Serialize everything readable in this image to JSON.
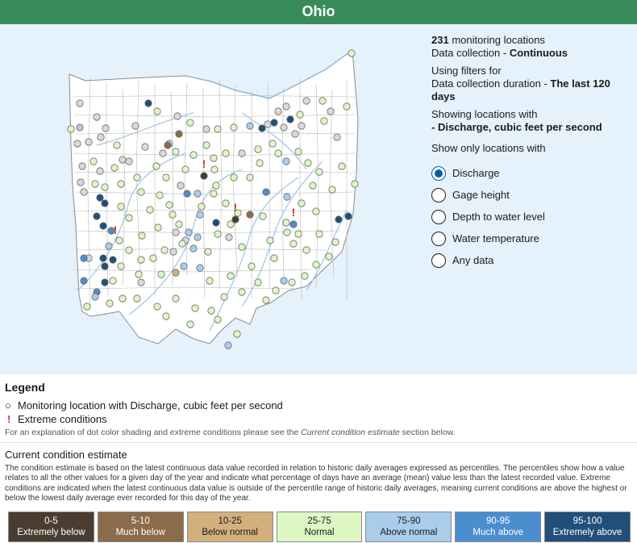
{
  "header": {
    "title": "Ohio"
  },
  "info": {
    "count": "231",
    "count_suffix": " monitoring locations",
    "collection_prefix": "Data collection - ",
    "collection_value": "Continuous",
    "filters_line1": "Using filters for",
    "filters_line2_prefix": "Data collection duration - ",
    "filters_line2_value": "The last 120 days",
    "showing_line1": "Showing locations with",
    "showing_line2": "- Discharge, cubic feet per second"
  },
  "filter": {
    "title": "Show only locations with",
    "options": [
      "Discharge",
      "Gage height",
      "Depth to water level",
      "Water temperature",
      "Any data"
    ],
    "selected": "Discharge"
  },
  "legend": {
    "title": "Legend",
    "item_location": "Monitoring location with Discharge, cubic feet per second",
    "item_extreme": "Extreme conditions",
    "note_prefix": "For an explanation of dot color shading and extreme conditions please see the ",
    "note_link": "Current condition estimate",
    "note_suffix": " section below.",
    "location_symbol": "○",
    "extreme_symbol": "!"
  },
  "condition": {
    "title": "Current condition estimate",
    "description": "The condition estimate is based on the latest continuous data value recorded in relation to historic daily averages expressed as percentiles. The percentiles show how a value relates to all the other values for a given day of the year and indicate what percentage of days have an average (mean) value less than the latest recorded value. Extreme conditions are indicated when the latest continuous data value is outside of the percentile range of historic daily averages, meaning current conditions are above the highest or below the lowest daily average ever recorded for this day of the year.",
    "scale": [
      {
        "range": "0-5",
        "label": "Extremely below",
        "color": "#4a3d2f",
        "text": "#ffffff"
      },
      {
        "range": "5-10",
        "label": "Much below",
        "color": "#8c6b4a",
        "text": "#ffffff"
      },
      {
        "range": "10-25",
        "label": "Below normal",
        "color": "#d2b07c",
        "text": "#1b1b1b"
      },
      {
        "range": "25-75",
        "label": "Normal",
        "color": "#dcf7c4",
        "text": "#1b1b1b"
      },
      {
        "range": "75-90",
        "label": "Above normal",
        "color": "#a9cdeb",
        "text": "#1b1b1b"
      },
      {
        "range": "90-95",
        "label": "Much above",
        "color": "#4b8ecf",
        "text": "#ffffff"
      },
      {
        "range": "95-100",
        "label": "Extremely above",
        "color": "#1f4f7a",
        "text": "#ffffff"
      }
    ]
  },
  "map": {
    "background": "#e6f2fb",
    "state_fill": "#ffffff",
    "colors": {
      "none": "#d9d9d9",
      "normal": "#dcf7c4",
      "above": "#a9cdeb",
      "much_above": "#4b8ecf",
      "ext_above": "#1f4f7a",
      "below": "#d2b07c",
      "much_below": "#8c6b4a",
      "ext_below": "#4a3d2f",
      "extreme_marker": "#d6332a"
    }
  }
}
